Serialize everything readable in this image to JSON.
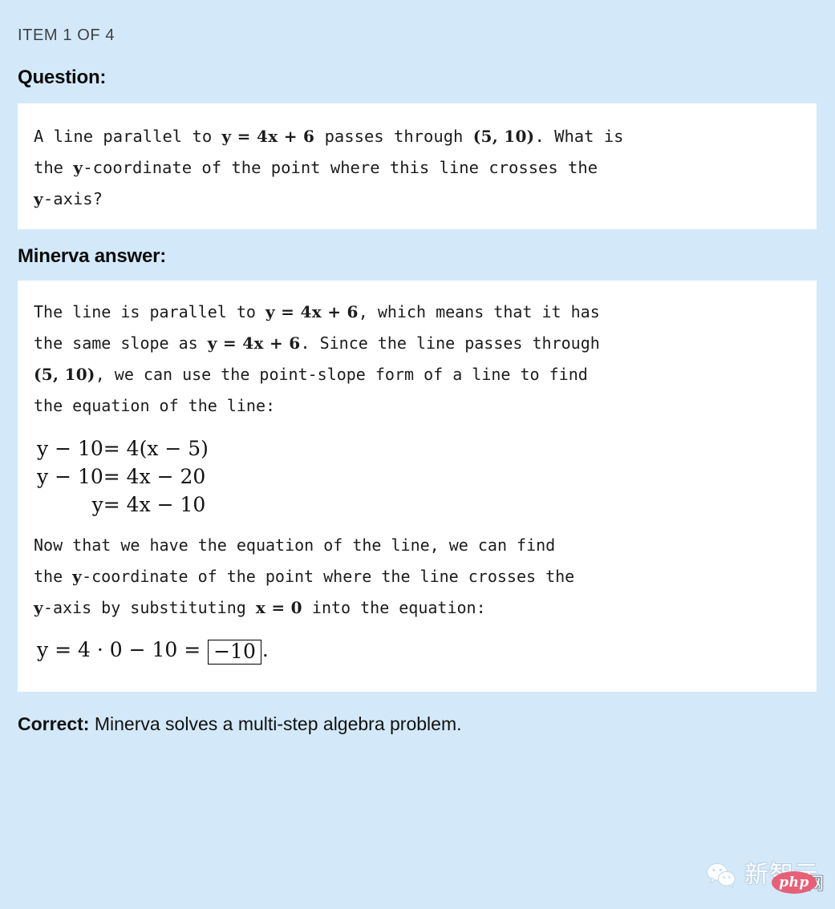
{
  "item_label": "ITEM 1 OF 4",
  "question": {
    "heading": "Question:",
    "line1_a": "A line parallel to ",
    "line1_math1": "y = 4x + 6",
    "line1_b": " passes through ",
    "line1_math2": "(5, 10)",
    "line1_c": ". What is",
    "line2_a": "the ",
    "line2_math": "y",
    "line2_b": "-coordinate of the point where this line crosses the",
    "line3_math": "y",
    "line3_a": "-axis?"
  },
  "answer": {
    "heading": "Minerva answer:",
    "p1_a": "The line is parallel to ",
    "p1_math1": "y = 4x + 6",
    "p1_b": ", which means that it has",
    "p1_c": "the same slope as ",
    "p1_math2": "y = 4x + 6",
    "p1_d": ". Since the line passes through",
    "p1_math3": "(5, 10)",
    "p1_e": ", we can use the point-slope form of a line to find",
    "p1_f": "the equation of the line:",
    "equations": [
      {
        "lhs": "y − 10",
        "rhs": "= 4(x − 5)"
      },
      {
        "lhs": "y − 10",
        "rhs": "= 4x − 20"
      },
      {
        "lhs": "y",
        "rhs": "= 4x − 10"
      }
    ],
    "p2_a": "Now that we have the equation of the line, we can find",
    "p2_b": "the ",
    "p2_math1": "y",
    "p2_c": "-coordinate of the point where the line crosses the",
    "p2_math2": "y",
    "p2_d": "-axis by substituting ",
    "p2_math3": "x = 0",
    "p2_e": " into the equation:",
    "final_eq_lead": "y = 4 · 0 − 10 = ",
    "final_eq_boxed": "−10",
    "final_eq_tail": "."
  },
  "verdict": {
    "label": "Correct:",
    "text": " Minerva solves a multi-step algebra problem."
  },
  "watermark": {
    "icon": "wechat-icon",
    "brand": "新智元",
    "badge": "php",
    "suffix": "中文网"
  },
  "colors": {
    "background": "#d3e9fa",
    "box": "#ffffff",
    "text": "#1c1c1c",
    "badge_red": "#e8556e"
  }
}
